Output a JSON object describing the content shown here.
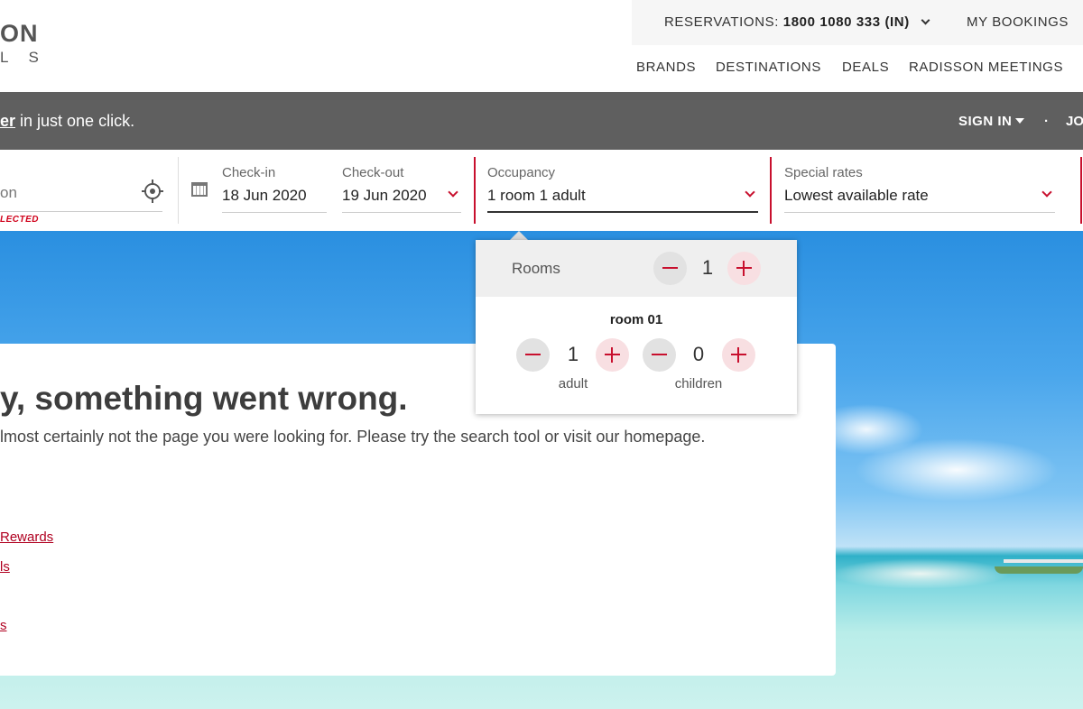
{
  "header": {
    "logo_line1": "ON",
    "logo_line2": "L S",
    "reservations_label": "RESERVATIONS:",
    "reservations_number": "1800 1080 333 (IN)",
    "my_bookings": "MY BOOKINGS",
    "nav": [
      "BRANDS",
      "DESTINATIONS",
      "DEALS",
      "RADISSON MEETINGS"
    ]
  },
  "promo": {
    "link": "er",
    "text": " in just one click.",
    "sign_in": "SIGN IN",
    "separator": "·",
    "join": "JO"
  },
  "search": {
    "destination_text": "on",
    "destination_error": "LECTED",
    "checkin_label": "Check-in",
    "checkin_value": "18 Jun 2020",
    "checkout_label": "Check-out",
    "checkout_value": "19 Jun 2020",
    "occupancy_label": "Occupancy",
    "occupancy_value": "1 room  1 adult",
    "special_label": "Special rates",
    "special_value": "Lowest available rate"
  },
  "occupancy_dropdown": {
    "rooms_label": "Rooms",
    "rooms_count": "1",
    "room_title": "room 01",
    "adult_count": "1",
    "adult_label": "adult",
    "children_count": "0",
    "children_label": "children"
  },
  "error_card": {
    "title": "y, something went wrong.",
    "description": "lmost certainly not the page you were looking for. Please try the search tool or visit our homepage.",
    "links": [
      "Rewards",
      "ls",
      "s"
    ]
  },
  "colors": {
    "brand_red": "#c8102e",
    "promo_gray": "#5f5f5f"
  }
}
